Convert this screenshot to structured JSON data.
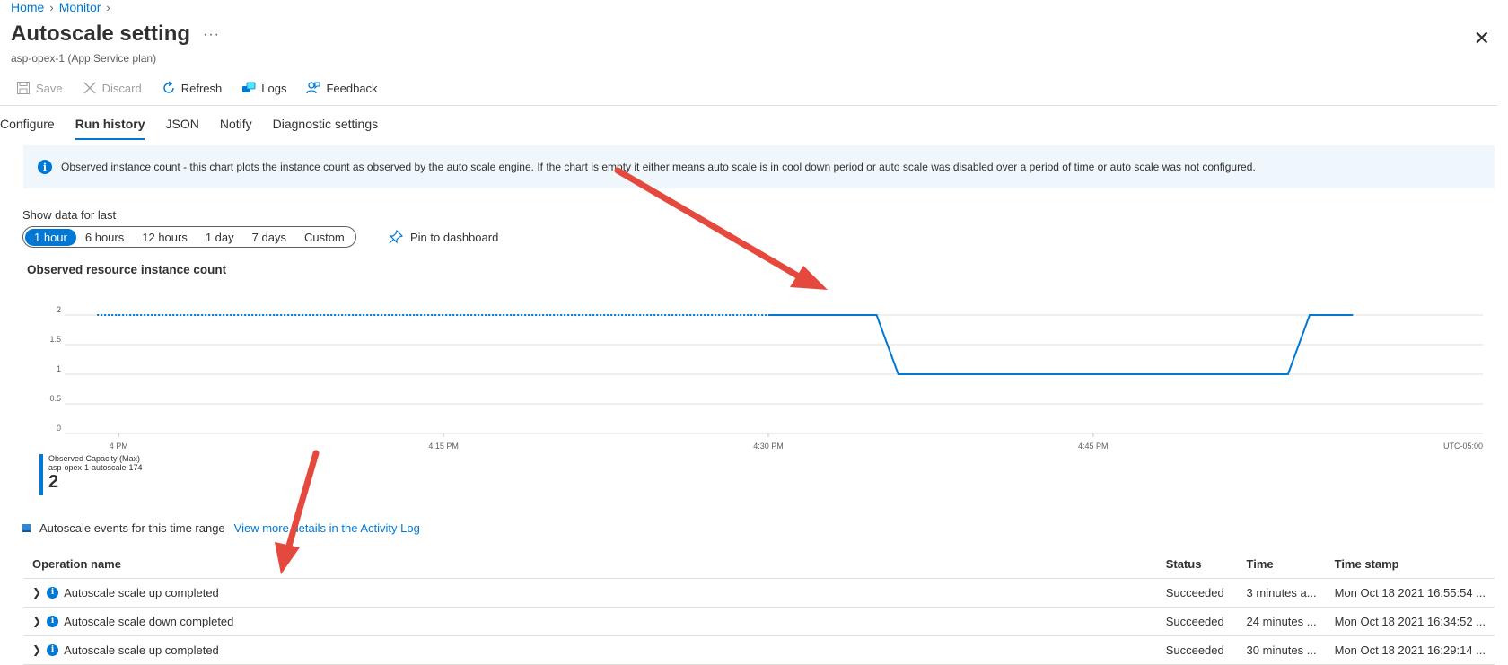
{
  "breadcrumb": {
    "home": "Home",
    "monitor": "Monitor"
  },
  "header": {
    "title": "Autoscale setting",
    "more": "···",
    "subtitle": "asp-opex-1 (App Service plan)",
    "close_icon": "close-icon"
  },
  "toolbar": {
    "save": "Save",
    "discard": "Discard",
    "refresh": "Refresh",
    "logs": "Logs",
    "feedback": "Feedback"
  },
  "tabs": [
    {
      "label": "Configure",
      "active": false
    },
    {
      "label": "Run history",
      "active": true
    },
    {
      "label": "JSON",
      "active": false
    },
    {
      "label": "Notify",
      "active": false
    },
    {
      "label": "Diagnostic settings",
      "active": false
    }
  ],
  "banner": {
    "text": "Observed instance count - this chart plots the instance count as observed by the auto scale engine. If the chart is empty it either means auto scale is in cool down period or auto scale was disabled over a period of time or auto scale was not configured."
  },
  "time_range": {
    "label": "Show data for last",
    "options": [
      "1 hour",
      "6 hours",
      "12 hours",
      "1 day",
      "7 days",
      "Custom"
    ],
    "selected": "1 hour",
    "pin": "Pin to dashboard"
  },
  "chart_data": {
    "type": "line",
    "title": "Observed resource instance count",
    "xlabel": "",
    "ylabel": "",
    "yticks": [
      "0",
      "0.5",
      "1",
      "1.5",
      "2"
    ],
    "ylim": [
      0,
      2
    ],
    "xticks": [
      "4 PM",
      "4:15 PM",
      "4:30 PM",
      "4:45 PM"
    ],
    "timezone": "UTC-05:00",
    "grid": true,
    "series": [
      {
        "name": "Observed Capacity (Max)",
        "resource": "asp-opex-1-autoscale-174",
        "color": "#0078d4",
        "dotted_segment": {
          "x": [
            "15:59",
            "16:30"
          ],
          "y": [
            2,
            2
          ]
        },
        "x": [
          "16:30",
          "16:35",
          "16:36",
          "16:54",
          "16:55",
          "16:57"
        ],
        "y": [
          2,
          2,
          1,
          1,
          2,
          2
        ]
      }
    ],
    "legend": {
      "label": "Observed Capacity (Max)",
      "sub": "asp-opex-1-autoscale-174",
      "value": "2"
    }
  },
  "events": {
    "heading": "Autoscale events for this time range",
    "link": "View more details in the Activity Log",
    "columns": [
      "Operation name",
      "Status",
      "Time",
      "Time stamp"
    ],
    "rows": [
      {
        "name": "Autoscale scale up completed",
        "status": "Succeeded",
        "time": "3 minutes a...",
        "stamp": "Mon Oct 18 2021 16:55:54 ..."
      },
      {
        "name": "Autoscale scale down completed",
        "status": "Succeeded",
        "time": "24 minutes ...",
        "stamp": "Mon Oct 18 2021 16:34:52 ..."
      },
      {
        "name": "Autoscale scale up completed",
        "status": "Succeeded",
        "time": "30 minutes ...",
        "stamp": "Mon Oct 18 2021 16:29:14 ..."
      }
    ]
  },
  "colors": {
    "accent": "#0078d4",
    "annotation": "#e5483c"
  }
}
